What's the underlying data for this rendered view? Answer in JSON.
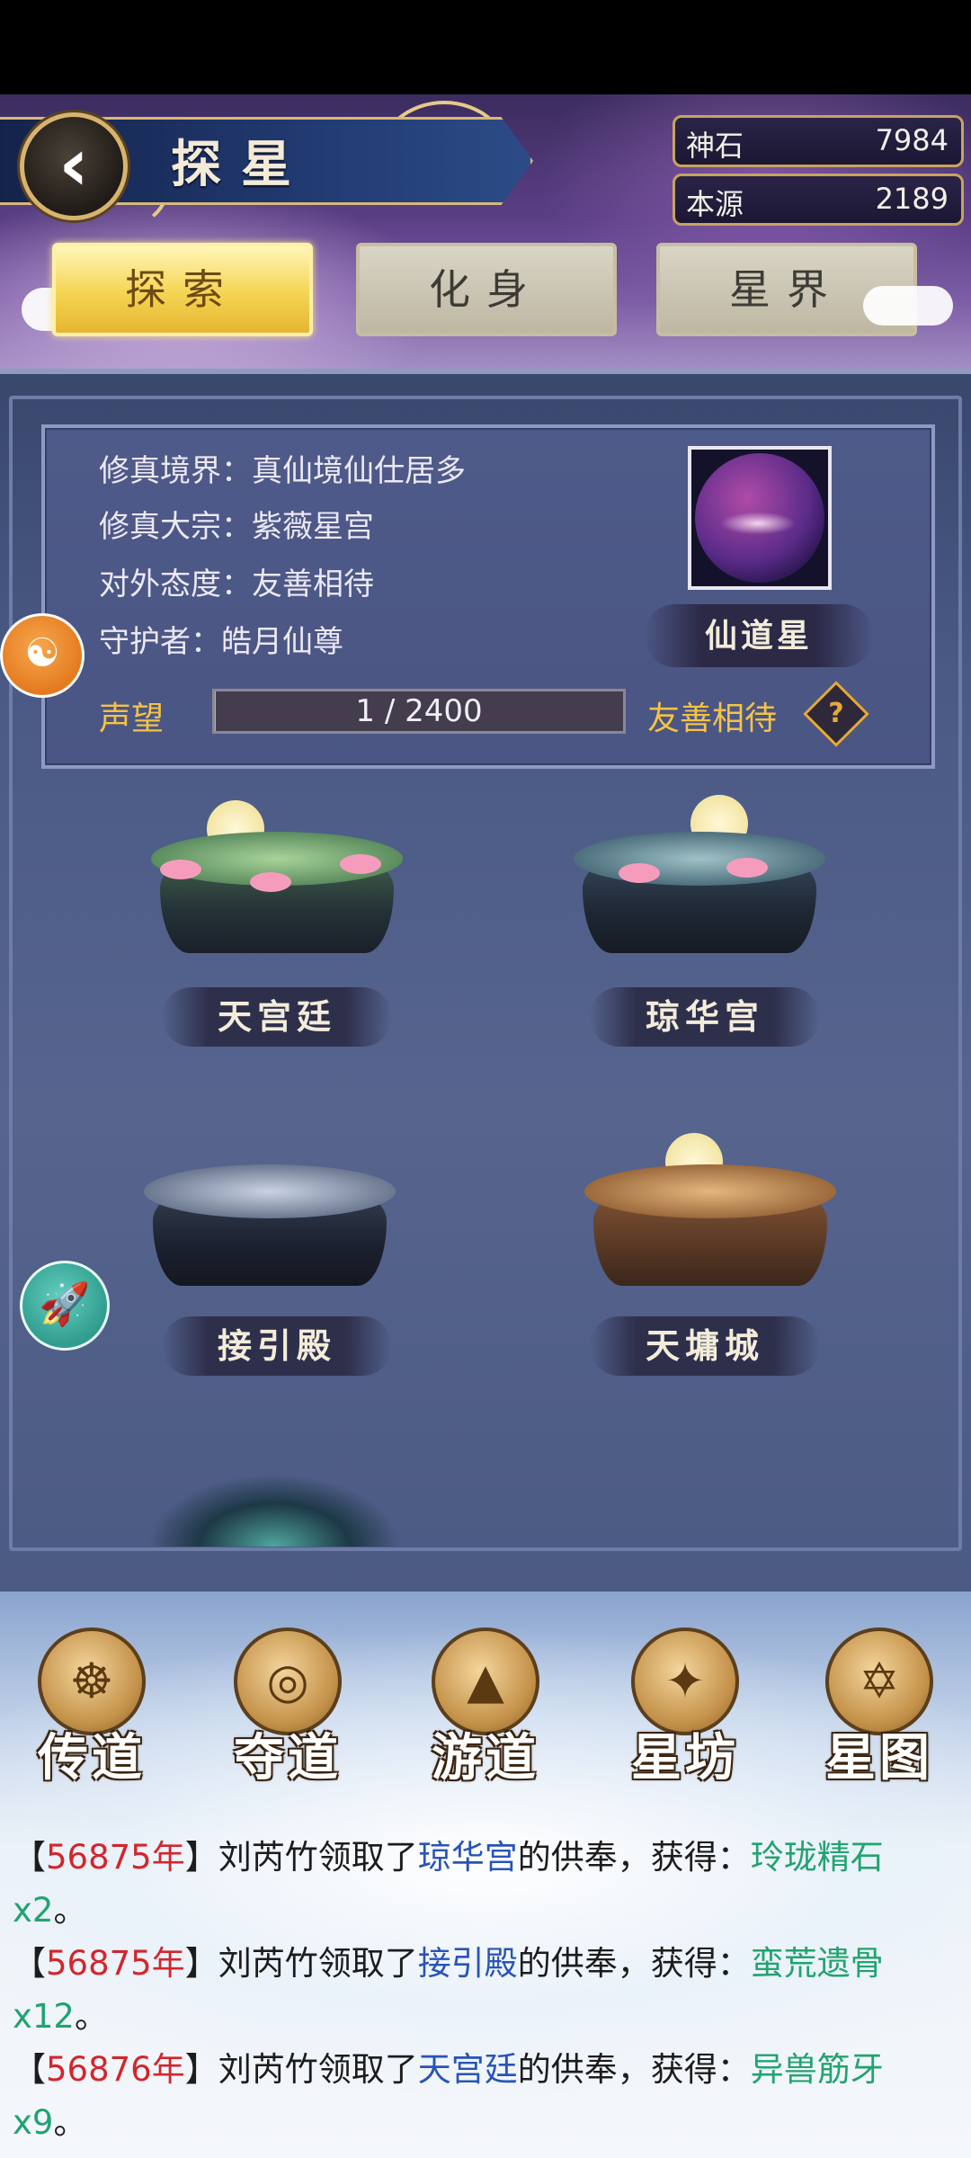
{
  "header": {
    "title": "探星",
    "back_icon": "chevron-left-icon"
  },
  "resources": [
    {
      "label": "神石",
      "value": "7984"
    },
    {
      "label": "本源",
      "value": "2189"
    }
  ],
  "tabs": [
    {
      "label": "探索",
      "active": true
    },
    {
      "label": "化身",
      "active": false
    },
    {
      "label": "星界",
      "active": false
    }
  ],
  "info": {
    "realm": "修真境界：真仙境仙仕居多",
    "sect": "修真大宗：紫薇星宫",
    "attitude_line": "对外态度：友善相待",
    "guardian": "守护者：皓月仙尊",
    "planet_name": "仙道星",
    "reputation_label": "声望",
    "reputation_text": "1 / 2400",
    "reputation_fraction": 0.0004,
    "attitude": "友善相待",
    "help_icon": "question-diamond-icon",
    "help_glyph": "?"
  },
  "locations": [
    {
      "name": "天宫廷"
    },
    {
      "name": "琼华宫"
    },
    {
      "name": "接引殿"
    },
    {
      "name": "天墉城"
    }
  ],
  "side_buttons": {
    "top_icon": "dragon-icon",
    "rocket_icon": "rocket-icon"
  },
  "nav": [
    {
      "label": "传道",
      "icon": "triskelion-icon"
    },
    {
      "label": "夺道",
      "icon": "orbit-icon"
    },
    {
      "label": "游道",
      "icon": "triangle-swirl-icon"
    },
    {
      "label": "星坊",
      "icon": "constellation-icon"
    },
    {
      "label": "星图",
      "icon": "hexagram-icon"
    }
  ],
  "log": [
    {
      "prefix": "【",
      "year": "56875年",
      "mid1": "】刘芮竹领取了",
      "place": "琼华宫",
      "mid2": "的供奉，获得：",
      "item": "玲珑精石x2",
      "suffix": "。"
    },
    {
      "prefix": "【",
      "year": "56875年",
      "mid1": "】刘芮竹领取了",
      "place": "接引殿",
      "mid2": "的供奉，获得：",
      "item": "蛮荒遗骨x12",
      "suffix": "。"
    },
    {
      "prefix": "【",
      "year": "56876年",
      "mid1": "】刘芮竹领取了",
      "place": "天宫廷",
      "mid2": "的供奉，获得：",
      "item": "异兽筋牙x9",
      "suffix": "。"
    }
  ]
}
